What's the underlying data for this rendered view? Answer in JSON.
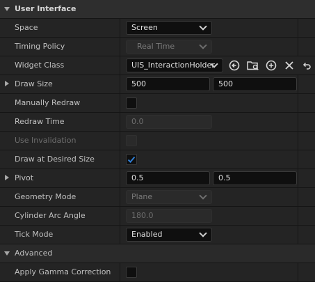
{
  "sections": {
    "user_interface": "User Interface",
    "advanced": "Advanced"
  },
  "rows": {
    "space": {
      "label": "Space",
      "value": "Screen"
    },
    "timing_policy": {
      "label": "Timing Policy",
      "value": "Real Time"
    },
    "widget_class": {
      "label": "Widget Class",
      "value": "UIS_InteractionHolder"
    },
    "draw_size": {
      "label": "Draw Size",
      "x": "500",
      "y": "500"
    },
    "manually_redraw": {
      "label": "Manually Redraw",
      "checked": false
    },
    "redraw_time": {
      "label": "Redraw Time",
      "value": "0.0"
    },
    "use_invalidation": {
      "label": "Use Invalidation",
      "checked": false
    },
    "draw_at_desired_size": {
      "label": "Draw at Desired Size",
      "checked": true
    },
    "pivot": {
      "label": "Pivot",
      "x": "0.5",
      "y": "0.5"
    },
    "geometry_mode": {
      "label": "Geometry Mode",
      "value": "Plane"
    },
    "cylinder_arc_angle": {
      "label": "Cylinder Arc Angle",
      "value": "180.0"
    },
    "tick_mode": {
      "label": "Tick Mode",
      "value": "Enabled"
    },
    "apply_gamma_correction": {
      "label": "Apply Gamma Correction",
      "checked": false
    }
  },
  "icons": {
    "browse": "arrow-left-circle-icon",
    "folder": "folder-search-icon",
    "add": "plus-circle-icon",
    "clear": "close-icon",
    "reset": "reset-arrow-icon"
  },
  "colors": {
    "check_accent": "#2f7fd6"
  }
}
